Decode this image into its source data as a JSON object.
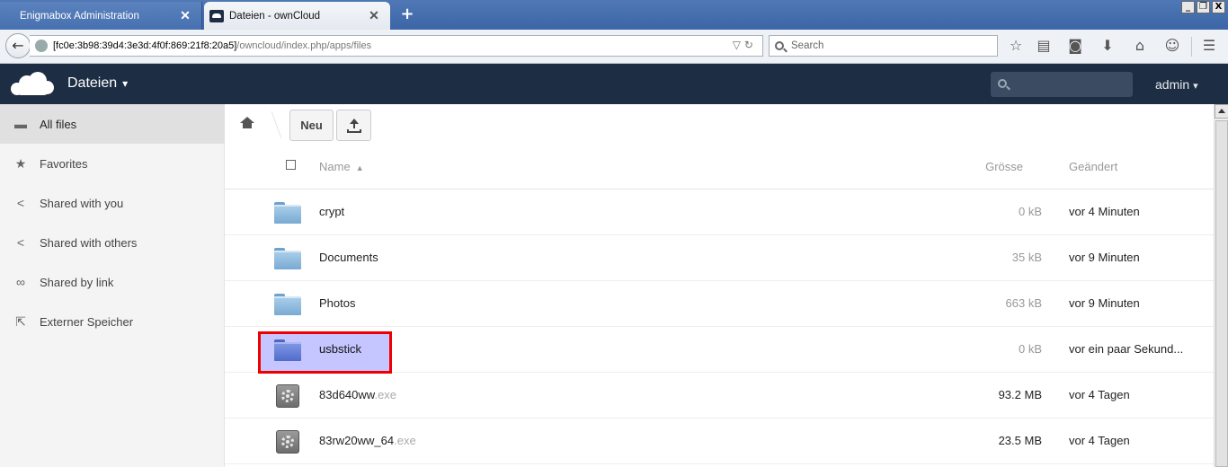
{
  "browser": {
    "tabs": [
      {
        "title": "Enigmabox Administration",
        "close": "✕"
      },
      {
        "title": "Dateien - ownCloud",
        "close": "✕"
      }
    ],
    "newtab": "+",
    "window_controls": {
      "minimize": "_",
      "restore": "❐",
      "close": "X"
    },
    "url_host": "[fc0e:3b98:39d4:3e3d:4f0f:869:21f8:20a5]",
    "url_path": "/owncloud/index.php/apps/files",
    "search_placeholder": "Search"
  },
  "header": {
    "app_name": "Dateien",
    "caret": "▾",
    "user": "admin"
  },
  "sidebar": {
    "items": [
      {
        "label": "All files",
        "icon": "folder-icon"
      },
      {
        "label": "Favorites",
        "icon": "star-icon"
      },
      {
        "label": "Shared with you",
        "icon": "share-icon"
      },
      {
        "label": "Shared with others",
        "icon": "share-icon"
      },
      {
        "label": "Shared by link",
        "icon": "link-icon"
      },
      {
        "label": "Externer Speicher",
        "icon": "external-icon"
      }
    ]
  },
  "toolbar": {
    "new_label": "Neu"
  },
  "table": {
    "headers": {
      "name": "Name",
      "sort": "▲",
      "size": "Grösse",
      "modified": "Geändert"
    },
    "rows": [
      {
        "name": "crypt",
        "ext": "",
        "size": "0 kB",
        "modified": "vor 4 Minuten",
        "type": "folder"
      },
      {
        "name": "Documents",
        "ext": "",
        "size": "35 kB",
        "modified": "vor 9 Minuten",
        "type": "folder"
      },
      {
        "name": "Photos",
        "ext": "",
        "size": "663 kB",
        "modified": "vor 9 Minuten",
        "type": "folder"
      },
      {
        "name": "usbstick",
        "ext": "",
        "size": "0 kB",
        "modified": "vor ein paar Sekund...",
        "type": "folder-highlighted"
      },
      {
        "name": "83d640ww",
        "ext": ".exe",
        "size": "93.2 MB",
        "modified": "vor 4 Tagen",
        "type": "exe"
      },
      {
        "name": "83rw20ww_64",
        "ext": ".exe",
        "size": "23.5 MB",
        "modified": "vor 4 Tagen",
        "type": "exe"
      }
    ]
  },
  "colors": {
    "header_bg": "#1d2d44",
    "highlight_fill": "#9696ff",
    "highlight_border": "#e00000"
  }
}
